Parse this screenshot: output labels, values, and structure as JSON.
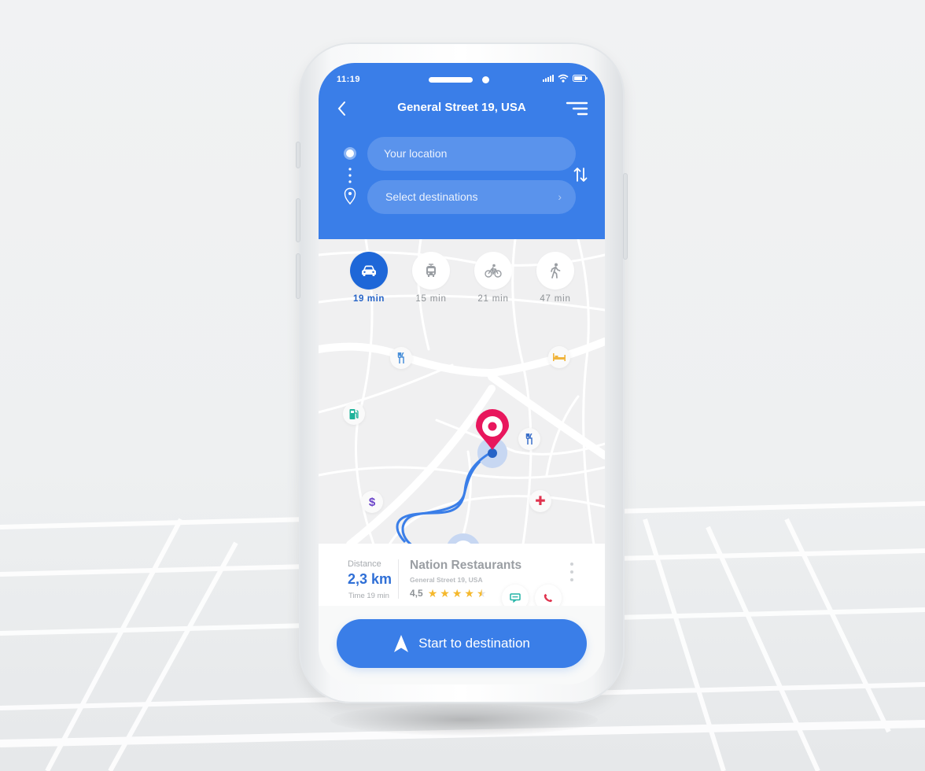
{
  "status_bar": {
    "time": "11:19"
  },
  "header": {
    "title": "General Street 19, USA",
    "back_icon": "chevron-left-icon",
    "menu_icon": "menu-icon"
  },
  "route": {
    "from_placeholder": "Your location",
    "to_placeholder": "Select destinations",
    "swap_icon": "swap-vertical-icon"
  },
  "transport_modes": [
    {
      "mode": "car",
      "icon": "car-icon",
      "time": "19 min",
      "active": true
    },
    {
      "mode": "transit",
      "icon": "bus-icon",
      "time": "15 min",
      "active": false
    },
    {
      "mode": "bike",
      "icon": "bicycle-icon",
      "time": "21 min",
      "active": false
    },
    {
      "mode": "walk",
      "icon": "walking-icon",
      "time": "47 min",
      "active": false
    }
  ],
  "map": {
    "pois": [
      {
        "type": "restaurant",
        "icon": "fork-knife-icon",
        "glyph": "🍴"
      },
      {
        "type": "hotel",
        "icon": "bed-icon",
        "glyph": "🛏"
      },
      {
        "type": "gas-station",
        "icon": "fuel-pump-icon",
        "glyph": "⛽"
      },
      {
        "type": "restaurant",
        "icon": "fork-knife-icon",
        "glyph": "🍴"
      },
      {
        "type": "bank",
        "icon": "dollar-icon",
        "glyph": "$"
      },
      {
        "type": "hospital",
        "icon": "medical-cross-icon",
        "glyph": "✚"
      }
    ],
    "route_color": "#3a7ee8",
    "destination_pin_color": "#e8175d"
  },
  "info_card": {
    "distance_label": "Distance",
    "distance_value": "2,3 km",
    "time_text": "Time 19 min",
    "place_name": "Nation Restaurants",
    "place_address": "General Street 19, USA",
    "rating": "4,5",
    "rating_value": 4.5,
    "rating_max": 5
  },
  "actions": {
    "message_icon": "message-icon",
    "call_icon": "phone-icon",
    "more_icon": "more-vertical-icon",
    "start_label": "Start to destination",
    "start_icon": "navigation-arrow-icon"
  },
  "colors": {
    "primary": "#3a7ee8",
    "primary_dark": "#1e67d8",
    "pin": "#e8175d",
    "star": "#f5b82c",
    "message": "#22b3a6",
    "call": "#e0344f"
  }
}
